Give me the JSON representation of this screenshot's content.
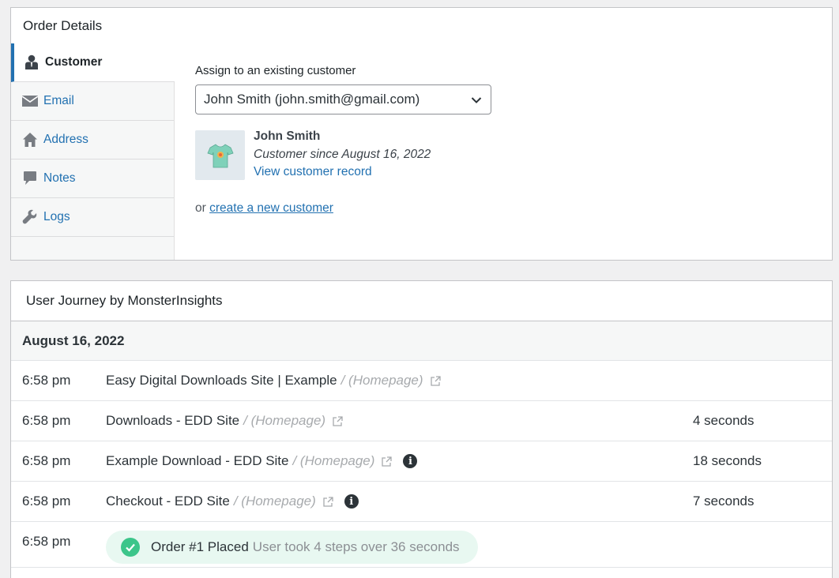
{
  "order_details": {
    "title": "Order Details",
    "tabs": [
      {
        "label": "Customer",
        "icon": "customer-icon",
        "active": true
      },
      {
        "label": "Email",
        "icon": "email-icon",
        "active": false
      },
      {
        "label": "Address",
        "icon": "home-icon",
        "active": false
      },
      {
        "label": "Notes",
        "icon": "notes-icon",
        "active": false
      },
      {
        "label": "Logs",
        "icon": "wrench-icon",
        "active": false
      }
    ],
    "assign_label": "Assign to an existing customer",
    "selected_customer": "John Smith (john.smith@gmail.com)",
    "customer": {
      "name": "John Smith",
      "since": "Customer since August 16, 2022",
      "view_link": "View customer record"
    },
    "create_prefix": "or",
    "create_link": "create a new customer"
  },
  "journey": {
    "title": "User Journey by MonsterInsights",
    "date": "August 16, 2022",
    "rows": [
      {
        "time": "6:58 pm",
        "page": "Easy Digital Downloads Site | Example",
        "sep": "/ (Homepage)",
        "duration": "",
        "info": false
      },
      {
        "time": "6:58 pm",
        "page": "Downloads - EDD Site",
        "sep": "/ (Homepage)",
        "duration": "4 seconds",
        "info": false
      },
      {
        "time": "6:58 pm",
        "page": "Example Download - EDD Site",
        "sep": "/ (Homepage)",
        "duration": "18 seconds",
        "info": true
      },
      {
        "time": "6:58 pm",
        "page": "Checkout - EDD Site",
        "sep": "/ (Homepage)",
        "duration": "7 seconds",
        "info": true
      }
    ],
    "order_row": {
      "time": "6:58 pm",
      "label": "Order #1 Placed",
      "detail": "User took 4 steps over 36 seconds"
    }
  },
  "colors": {
    "accent": "#2271b1",
    "success": "#3cc58a",
    "success_bg": "#e8f8f1"
  }
}
